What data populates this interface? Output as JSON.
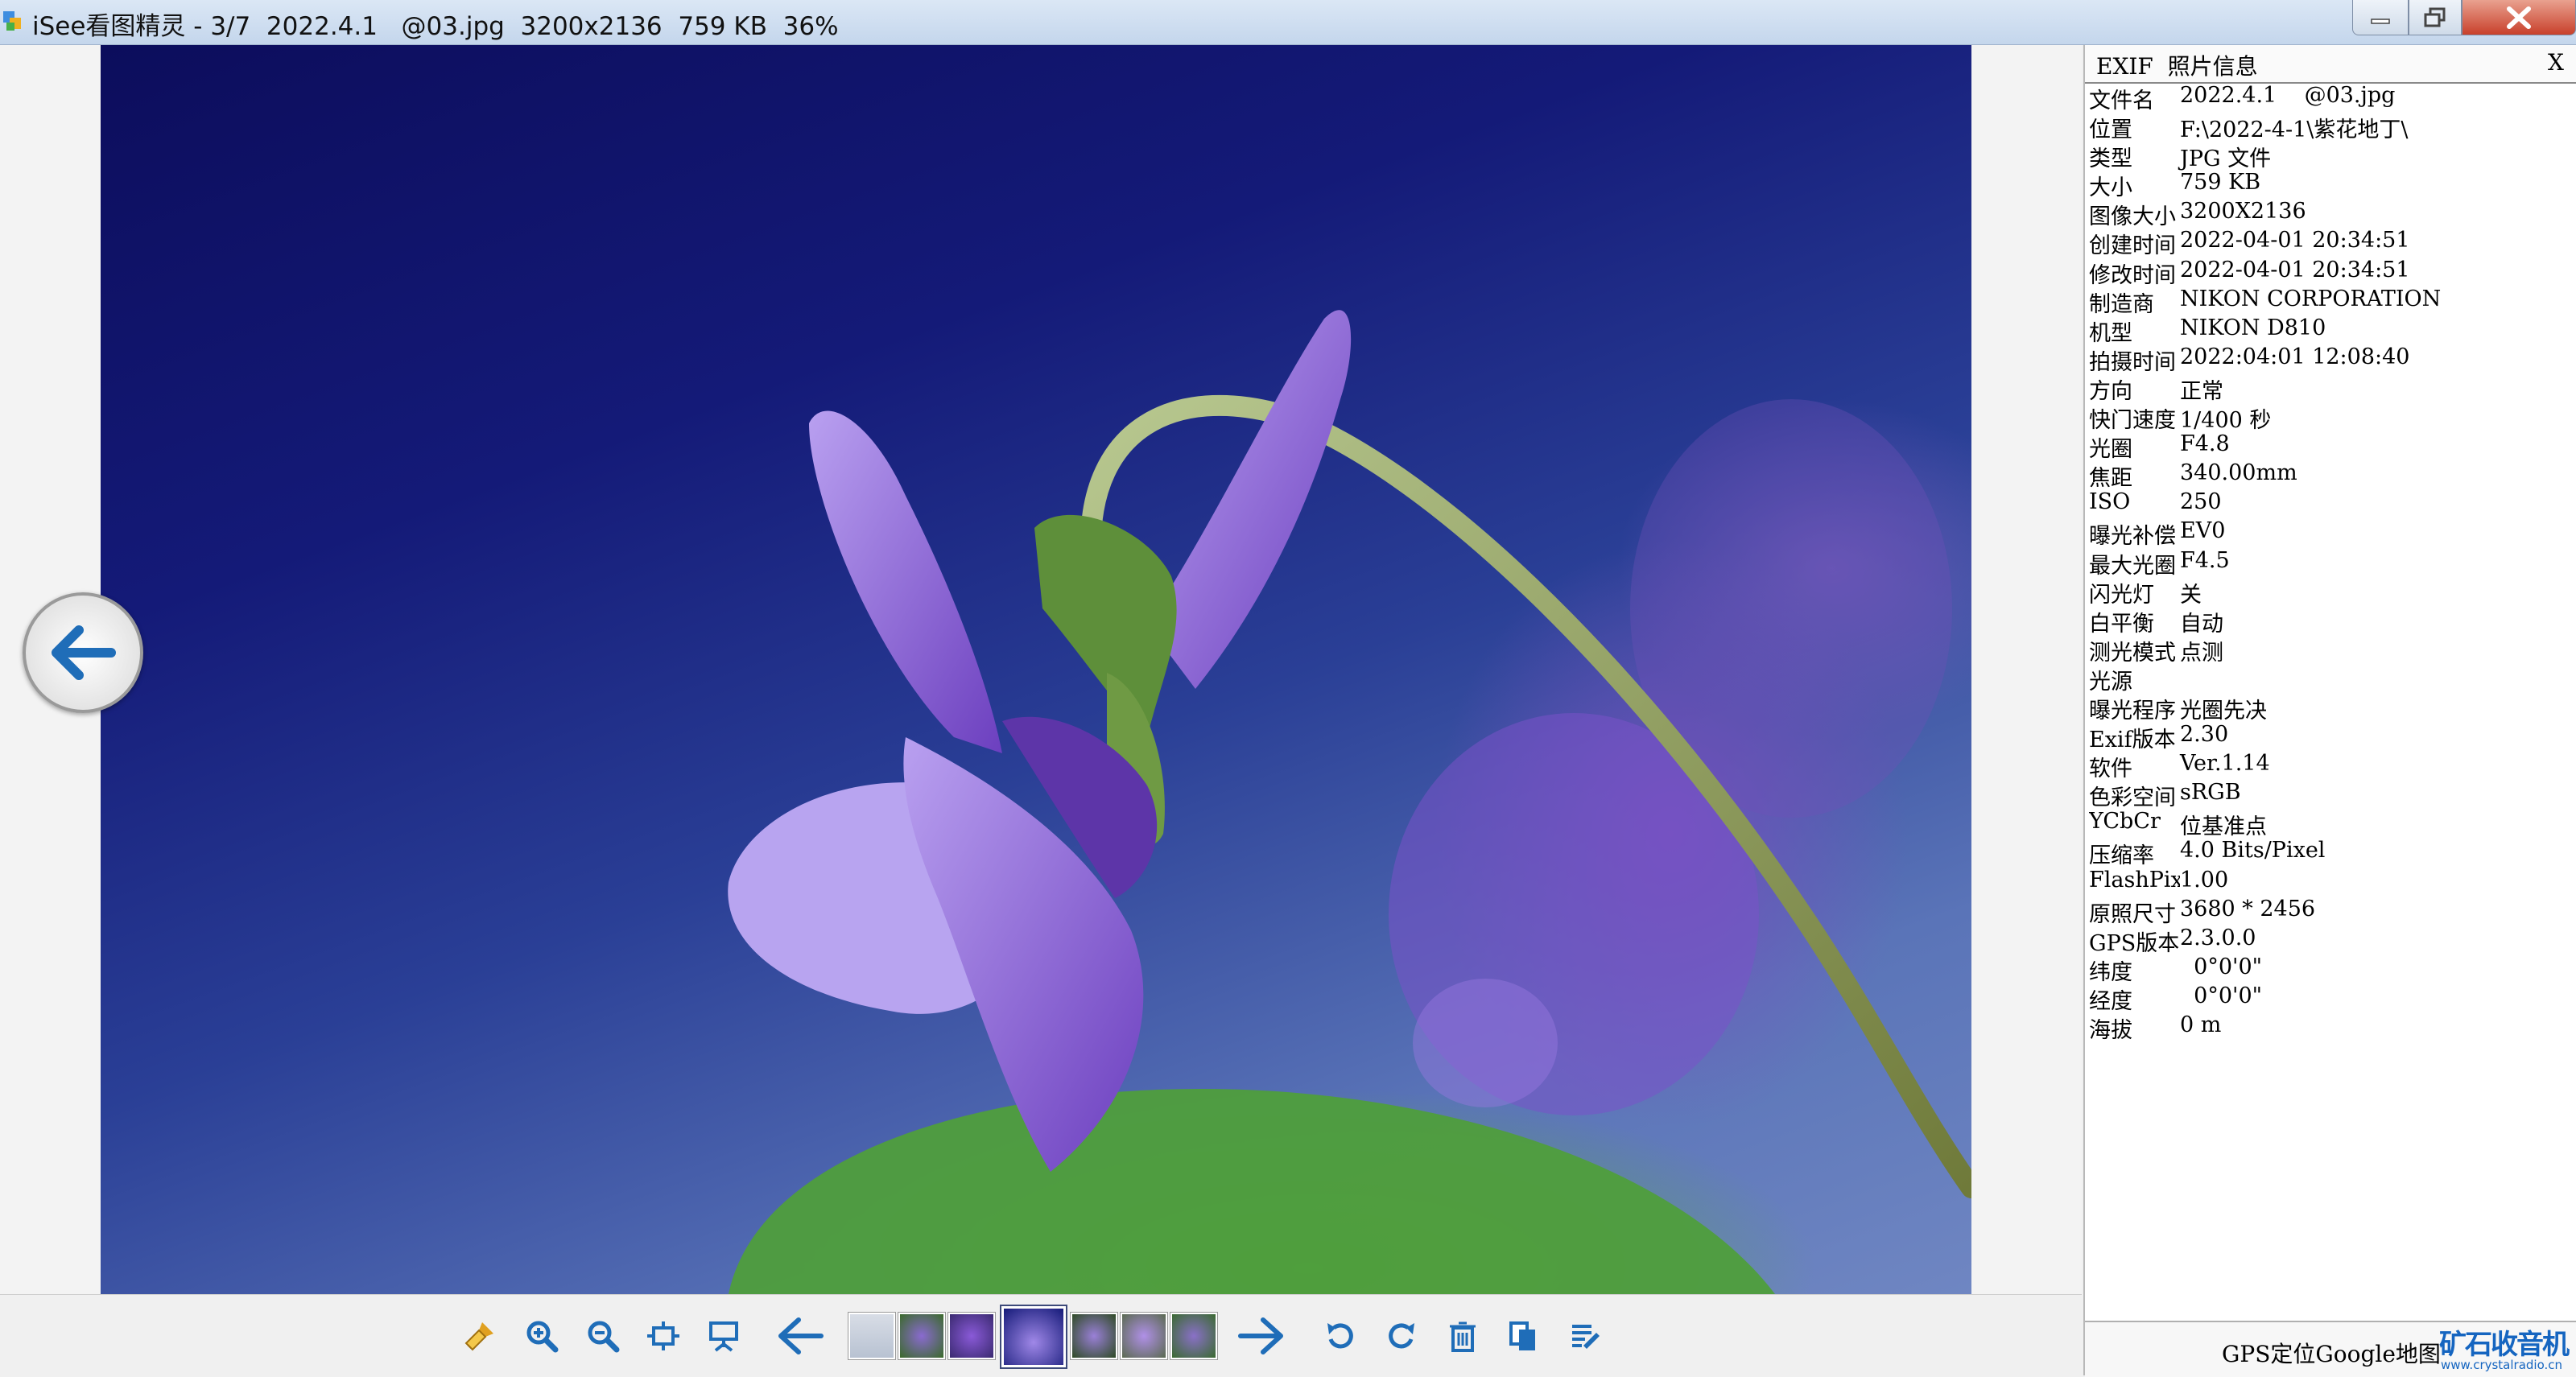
{
  "window": {
    "title": "iSee看图精灵 - 3/7  2022.4.1   @03.jpg  3200x2136  759 KB  36%",
    "icon": "isee-app-icon",
    "buttons": [
      "minimize-icon",
      "maximize-icon",
      "close-icon"
    ]
  },
  "viewer": {
    "image_label": "violet-flower-photo",
    "prev_icon": "arrow-left-circle-icon"
  },
  "exif_panel": {
    "title": "EXIF  照片信息",
    "close_label": "X",
    "rows": [
      {
        "key": "文件名",
        "value": "2022.4.1    @03.jpg"
      },
      {
        "key": "位置",
        "value": "F:\\2022-4-1\\紫花地丁\\"
      },
      {
        "key": "类型",
        "value": "JPG 文件"
      },
      {
        "key": "大小",
        "value": "759 KB"
      },
      {
        "key": "图像大小",
        "value": "3200X2136"
      },
      {
        "key": "创建时间",
        "value": "2022-04-01 20:34:51"
      },
      {
        "key": "修改时间",
        "value": "2022-04-01 20:34:51"
      },
      {
        "key": "制造商",
        "value": "NIKON CORPORATION"
      },
      {
        "key": "机型",
        "value": "NIKON D810"
      },
      {
        "key": "拍摄时间",
        "value": "2022:04:01 12:08:40"
      },
      {
        "key": "方向",
        "value": "正常"
      },
      {
        "key": "快门速度",
        "value": "1/400 秒"
      },
      {
        "key": "光圈",
        "value": "F4.8"
      },
      {
        "key": "焦距",
        "value": "340.00mm"
      },
      {
        "key": "ISO",
        "value": "250"
      },
      {
        "key": "曝光补偿",
        "value": "EV0"
      },
      {
        "key": "最大光圈",
        "value": "F4.5"
      },
      {
        "key": "闪光灯",
        "value": "关"
      },
      {
        "key": "白平衡",
        "value": "自动"
      },
      {
        "key": "测光模式",
        "value": "点测"
      },
      {
        "key": "光源",
        "value": ""
      },
      {
        "key": "曝光程序",
        "value": "光圈先决"
      },
      {
        "key": "Exif版本",
        "value": "2.30"
      },
      {
        "key": "软件",
        "value": "Ver.1.14"
      },
      {
        "key": "色彩空间",
        "value": "sRGB"
      },
      {
        "key": "YCbCr",
        "value": "位基准点"
      },
      {
        "key": "压缩率",
        "value": "4.0 Bits/Pixel"
      },
      {
        "key": "FlashPix",
        "value": "1.00"
      },
      {
        "key": "原照尺寸",
        "value": "3680 * 2456"
      },
      {
        "key": "GPS版本",
        "value": "2.3.0.0"
      },
      {
        "key": "纬度",
        "value": "  0°0'0\""
      },
      {
        "key": "经度",
        "value": "  0°0'0\""
      },
      {
        "key": "海拔",
        "value": "0 m"
      }
    ],
    "gps_link": "GPS定位Google地图"
  },
  "watermark": {
    "title": "矿石收音机",
    "subtitle": "www.crystalradio.cn"
  },
  "toolbar": {
    "icons": [
      "clean-brush-icon",
      "zoom-in-icon",
      "zoom-out-icon",
      "fit-window-icon",
      "slideshow-icon",
      "previous-arrow-icon",
      "next-arrow-icon",
      "rotate-left-icon",
      "rotate-right-icon",
      "delete-icon",
      "copy-icon",
      "edit-info-icon"
    ],
    "thumbnails": [
      "thumb-1",
      "thumb-2",
      "thumb-3",
      "thumb-4",
      "thumb-5",
      "thumb-6",
      "thumb-7"
    ],
    "active_thumbnail": 4
  },
  "colors": {
    "accent": "#2b6fb8",
    "photo_bg": "#141a78",
    "flower": "#8a5fd0"
  }
}
